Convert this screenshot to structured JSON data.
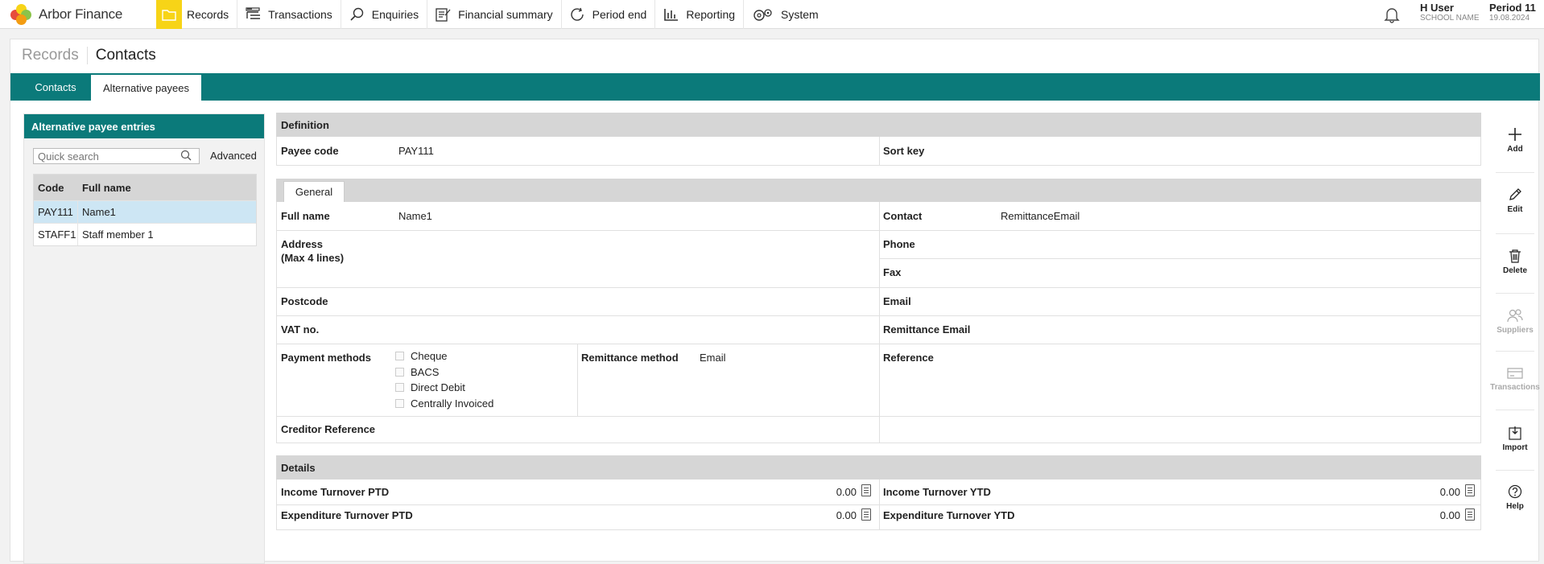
{
  "app": {
    "name": "Arbor Finance",
    "logo_colors": [
      "#e74c3c",
      "#f39c12",
      "#8bc34a",
      "#f7d417"
    ]
  },
  "nav": [
    {
      "label": "Records",
      "icon": "folder-icon",
      "active": true
    },
    {
      "label": "Transactions",
      "icon": "list-icon",
      "active": false
    },
    {
      "label": "Enquiries",
      "icon": "search-icon",
      "active": false
    },
    {
      "label": "Financial summary",
      "icon": "report-icon",
      "active": false
    },
    {
      "label": "Period end",
      "icon": "refresh-icon",
      "active": false
    },
    {
      "label": "Reporting",
      "icon": "bar-chart-icon",
      "active": false
    },
    {
      "label": "System",
      "icon": "cog-icon",
      "active": false
    }
  ],
  "user": {
    "name": "H User",
    "school": "SCHOOL NAME"
  },
  "period": {
    "label": "Period 11",
    "date": "19.08.2024"
  },
  "breadcrumb": {
    "parent": "Records",
    "current": "Contacts"
  },
  "tabs": [
    "Contacts",
    "Alternative payees"
  ],
  "left_panel": {
    "title": "Alternative payee entries",
    "search_placeholder": "Quick search",
    "advanced": "Advanced",
    "columns": [
      "Code",
      "Full name"
    ],
    "rows": [
      {
        "code": "PAY111",
        "name": "Name1",
        "selected": true
      },
      {
        "code": "STAFF1",
        "name": "Staff member 1",
        "selected": false
      }
    ]
  },
  "definition": {
    "title": "Definition",
    "payee_code_label": "Payee code",
    "payee_code": "PAY111",
    "sort_key_label": "Sort key",
    "sort_key": ""
  },
  "general": {
    "tab": "General",
    "full_name_label": "Full name",
    "full_name": "Name1",
    "contact_label": "Contact",
    "contact": "RemittanceEmail",
    "address_label": "Address",
    "address_hint": "(Max 4 lines)",
    "phone_label": "Phone",
    "fax_label": "Fax",
    "postcode_label": "Postcode",
    "email_label": "Email",
    "vat_label": "VAT no.",
    "remit_email_label": "Remittance Email",
    "payment_methods_label": "Payment methods",
    "payment_methods": [
      "Cheque",
      "BACS",
      "Direct Debit",
      "Centrally Invoiced"
    ],
    "remit_method_label": "Remittance method",
    "remit_method": "Email",
    "reference_label": "Reference",
    "creditor_ref_label": "Creditor Reference"
  },
  "details": {
    "title": "Details",
    "income_ptd_label": "Income Turnover PTD",
    "income_ptd": "0.00",
    "income_ytd_label": "Income Turnover YTD",
    "income_ytd": "0.00",
    "exp_ptd_label": "Expenditure Turnover PTD",
    "exp_ptd": "0.00",
    "exp_ytd_label": "Expenditure Turnover YTD",
    "exp_ytd": "0.00"
  },
  "actions": [
    {
      "label": "Add",
      "icon": "plus-icon",
      "enabled": true
    },
    {
      "label": "Edit",
      "icon": "pencil-icon",
      "enabled": true
    },
    {
      "label": "Delete",
      "icon": "trash-icon",
      "enabled": true
    },
    {
      "label": "Suppliers",
      "icon": "users-icon",
      "enabled": false
    },
    {
      "label": "Transactions",
      "icon": "card-icon",
      "enabled": false
    },
    {
      "label": "Import",
      "icon": "import-icon",
      "enabled": true
    },
    {
      "label": "Help",
      "icon": "help-icon",
      "enabled": true
    }
  ]
}
